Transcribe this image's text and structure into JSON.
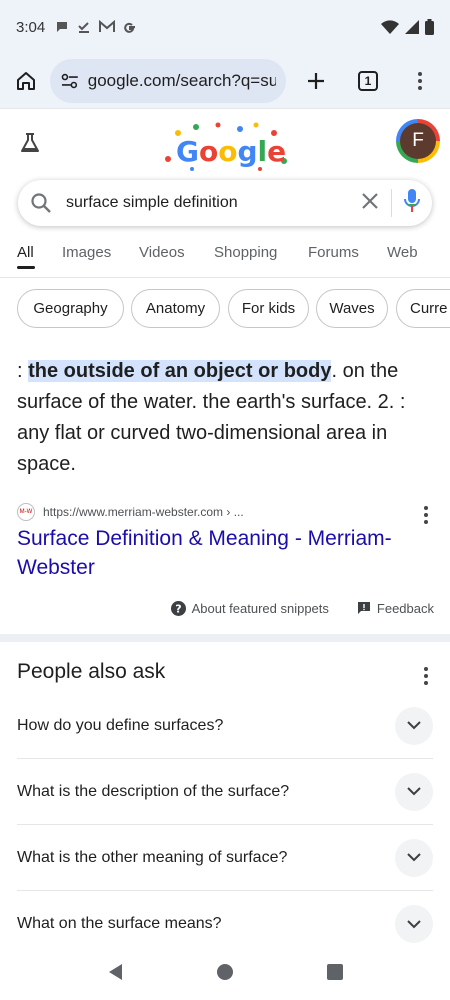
{
  "status_bar": {
    "time": "3:04",
    "left_icons": [
      "chat-bubble-icon",
      "download-check-icon",
      "gmail-icon",
      "google-g-icon"
    ],
    "right_icons": [
      "wifi-icon",
      "signal-icon",
      "battery-icon"
    ]
  },
  "browser": {
    "url": "google.com/search?q=su",
    "tab_count": "1"
  },
  "google": {
    "avatar_letter": "F"
  },
  "search": {
    "query": "surface simple definition"
  },
  "tabs": [
    "All",
    "Images",
    "Videos",
    "Shopping",
    "Forums",
    "Web"
  ],
  "chips": [
    "Geography",
    "Anatomy",
    "For kids",
    "Waves",
    "Curre"
  ],
  "snippet": {
    "prefix": ": ",
    "highlight": "the outside of an object or body",
    "rest": ". on the surface of the water. the earth's surface. 2. : any flat or curved two-dimensional area in space.",
    "favicon_text": "M-W",
    "source_url": "https://www.merriam-webster.com › ...",
    "result_title": "Surface Definition & Meaning - Merriam-Webster",
    "about_label": "About featured snippets",
    "feedback_label": "Feedback"
  },
  "people_also_ask": {
    "title": "People also ask",
    "questions": [
      "How do you define surfaces?",
      "What is the description of the surface?",
      "What is the other meaning of surface?",
      "What on the surface means?"
    ]
  },
  "colors": {
    "link": "#1a0dab",
    "highlight": "#d3e3fd",
    "browser_chrome": "#eef2f9",
    "mic_blue": "#4285f4",
    "mic_red": "#ea4335"
  }
}
